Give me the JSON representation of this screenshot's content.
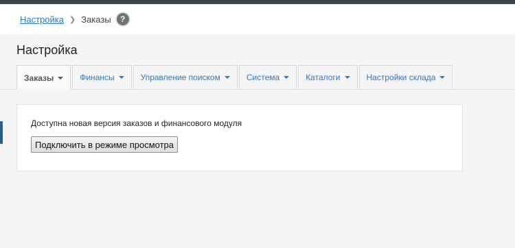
{
  "breadcrumb": {
    "link_label": "Настройка",
    "current_label": "Заказы",
    "help_glyph": "?"
  },
  "page": {
    "title": "Настройка"
  },
  "tabs": [
    {
      "label": "Заказы",
      "active": true
    },
    {
      "label": "Финансы",
      "active": false
    },
    {
      "label": "Управление поиском",
      "active": false
    },
    {
      "label": "Система",
      "active": false
    },
    {
      "label": "Каталоги",
      "active": false
    },
    {
      "label": "Настройки склада",
      "active": false
    }
  ],
  "notice": {
    "text": "Доступна новая версия заказов и финансового модуля",
    "button_label": "Подключить в режиме просмотра"
  },
  "colors": {
    "link": "#2b78c2",
    "topbar": "#3a4651",
    "background": "#f5f5f5"
  },
  "icons": [
    "chevron-right-icon",
    "help-icon",
    "caret-down-icon"
  ]
}
